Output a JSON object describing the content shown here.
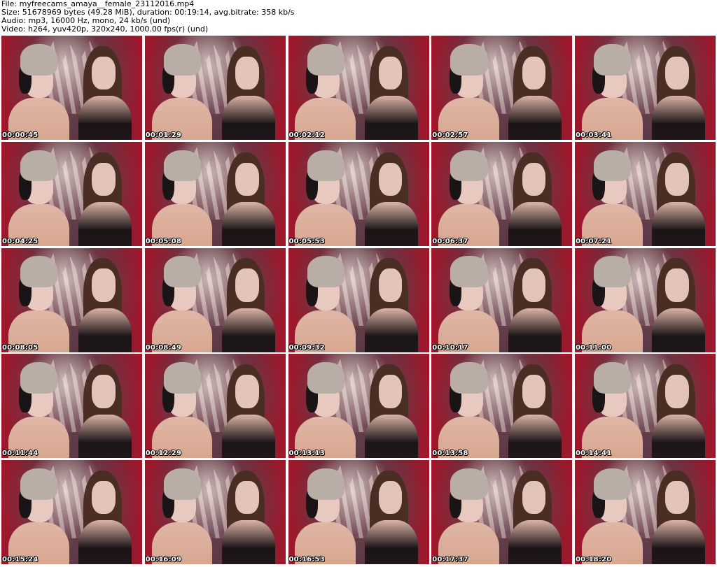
{
  "header": {
    "file_line": "File: myfreecams_amaya__female_23112016.mp4",
    "size_line": "Size: 51678969 bytes (49.28 MiB), duration: 00:19:14, avg.bitrate: 358 kb/s",
    "audio_line": "Audio: mp3, 16000 Hz, mono, 24 kb/s (und)",
    "video_line": "Video: h264, yuv420p, 320x240, 1000.00 fps(r) (und)"
  },
  "thumbnails": [
    {
      "timestamp": "00:00:45"
    },
    {
      "timestamp": "00:01:29"
    },
    {
      "timestamp": "00:02:12"
    },
    {
      "timestamp": "00:02:57"
    },
    {
      "timestamp": "00:03:41"
    },
    {
      "timestamp": "00:04:25"
    },
    {
      "timestamp": "00:05:08"
    },
    {
      "timestamp": "00:05:53"
    },
    {
      "timestamp": "00:06:37"
    },
    {
      "timestamp": "00:07:21"
    },
    {
      "timestamp": "00:08:05"
    },
    {
      "timestamp": "00:08:49"
    },
    {
      "timestamp": "00:09:32"
    },
    {
      "timestamp": "00:10:17"
    },
    {
      "timestamp": "00:11:00"
    },
    {
      "timestamp": "00:11:44"
    },
    {
      "timestamp": "00:12:29"
    },
    {
      "timestamp": "00:13:13"
    },
    {
      "timestamp": "00:13:58"
    },
    {
      "timestamp": "00:14:41"
    },
    {
      "timestamp": "00:15:24"
    },
    {
      "timestamp": "00:16:09"
    },
    {
      "timestamp": "00:16:53"
    },
    {
      "timestamp": "00:17:37"
    },
    {
      "timestamp": "00:18:20"
    }
  ]
}
